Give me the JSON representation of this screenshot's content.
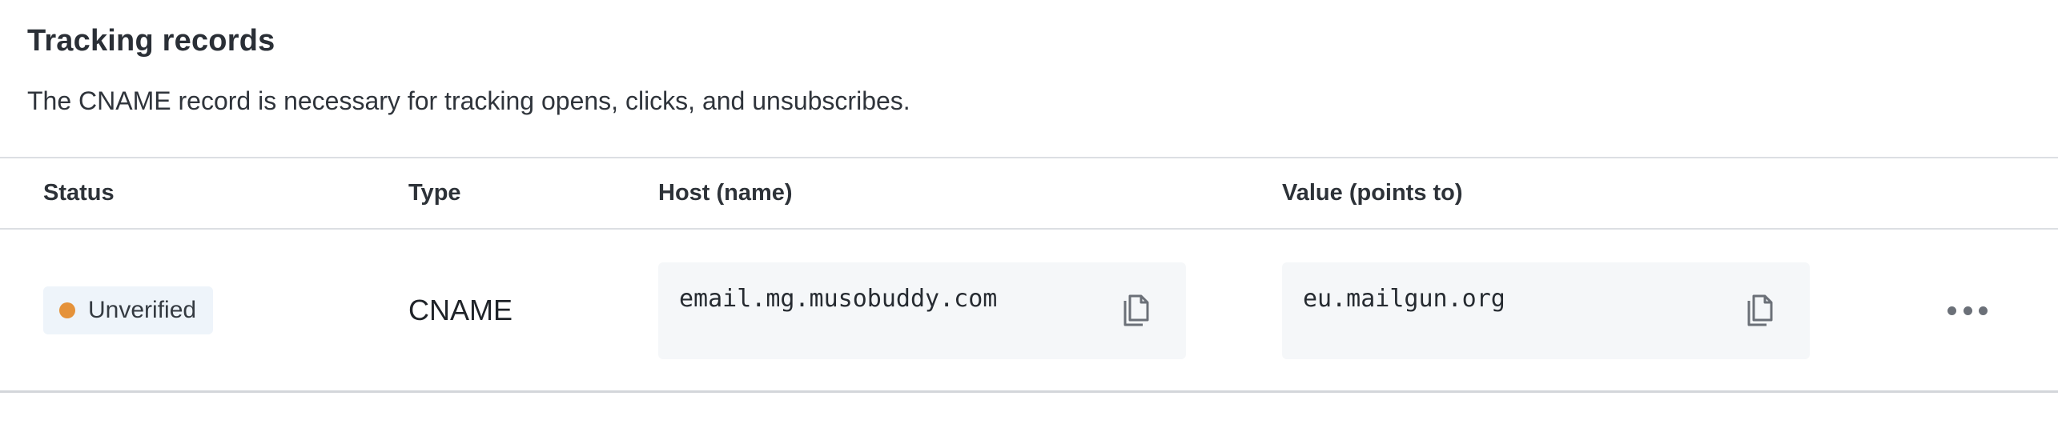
{
  "section": {
    "title": "Tracking records",
    "description": "The CNAME record is necessary for tracking opens, clicks, and unsubscribes."
  },
  "table": {
    "columns": [
      "Status",
      "Type",
      "Host (name)",
      "Value (points to)"
    ],
    "rows": [
      {
        "status": "Unverified",
        "status_color": "#e5923a",
        "type": "CNAME",
        "host": "email.mg.musobuddy.com",
        "value": "eu.mailgun.org"
      }
    ]
  },
  "icons": {
    "copy": "copy-icon",
    "more": "more-options-icon"
  }
}
